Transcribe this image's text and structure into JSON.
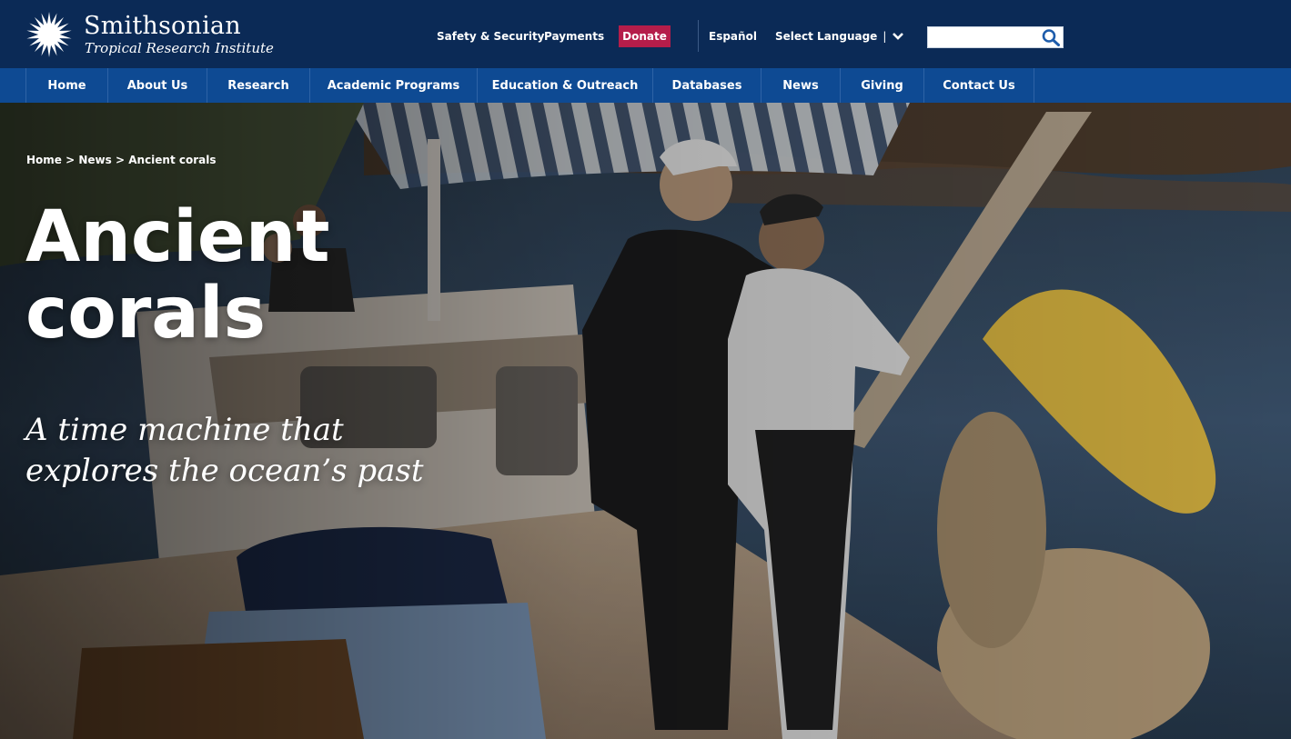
{
  "brand": {
    "name": "Smithsonian",
    "subtitle": "Tropical Research Institute"
  },
  "utility_nav": {
    "safety": "Safety & Security",
    "payments": "Payments",
    "donate": "Donate",
    "espanol": "Español",
    "select_language": "Select Language",
    "separator": "|"
  },
  "search": {
    "placeholder": ""
  },
  "main_nav": {
    "items": [
      {
        "label": "Home"
      },
      {
        "label": "About Us"
      },
      {
        "label": "Research"
      },
      {
        "label": "Academic Programs"
      },
      {
        "label": "Education & Outreach"
      },
      {
        "label": "Databases"
      },
      {
        "label": "News"
      },
      {
        "label": "Giving"
      },
      {
        "label": "Contact Us"
      }
    ]
  },
  "breadcrumb": {
    "items": [
      "Home",
      "News",
      "Ancient corals"
    ],
    "separator": ">"
  },
  "hero": {
    "title": "Ancient corals",
    "subtitle": "A time machine that explores the ocean’s past"
  },
  "colors": {
    "top_bar": "#0b2a56",
    "main_nav": "#0e4a93",
    "donate": "#b51d4a"
  },
  "icons": {
    "logo": "sunburst-icon",
    "language_dropdown": "chevron-down-icon",
    "search": "search-icon"
  }
}
